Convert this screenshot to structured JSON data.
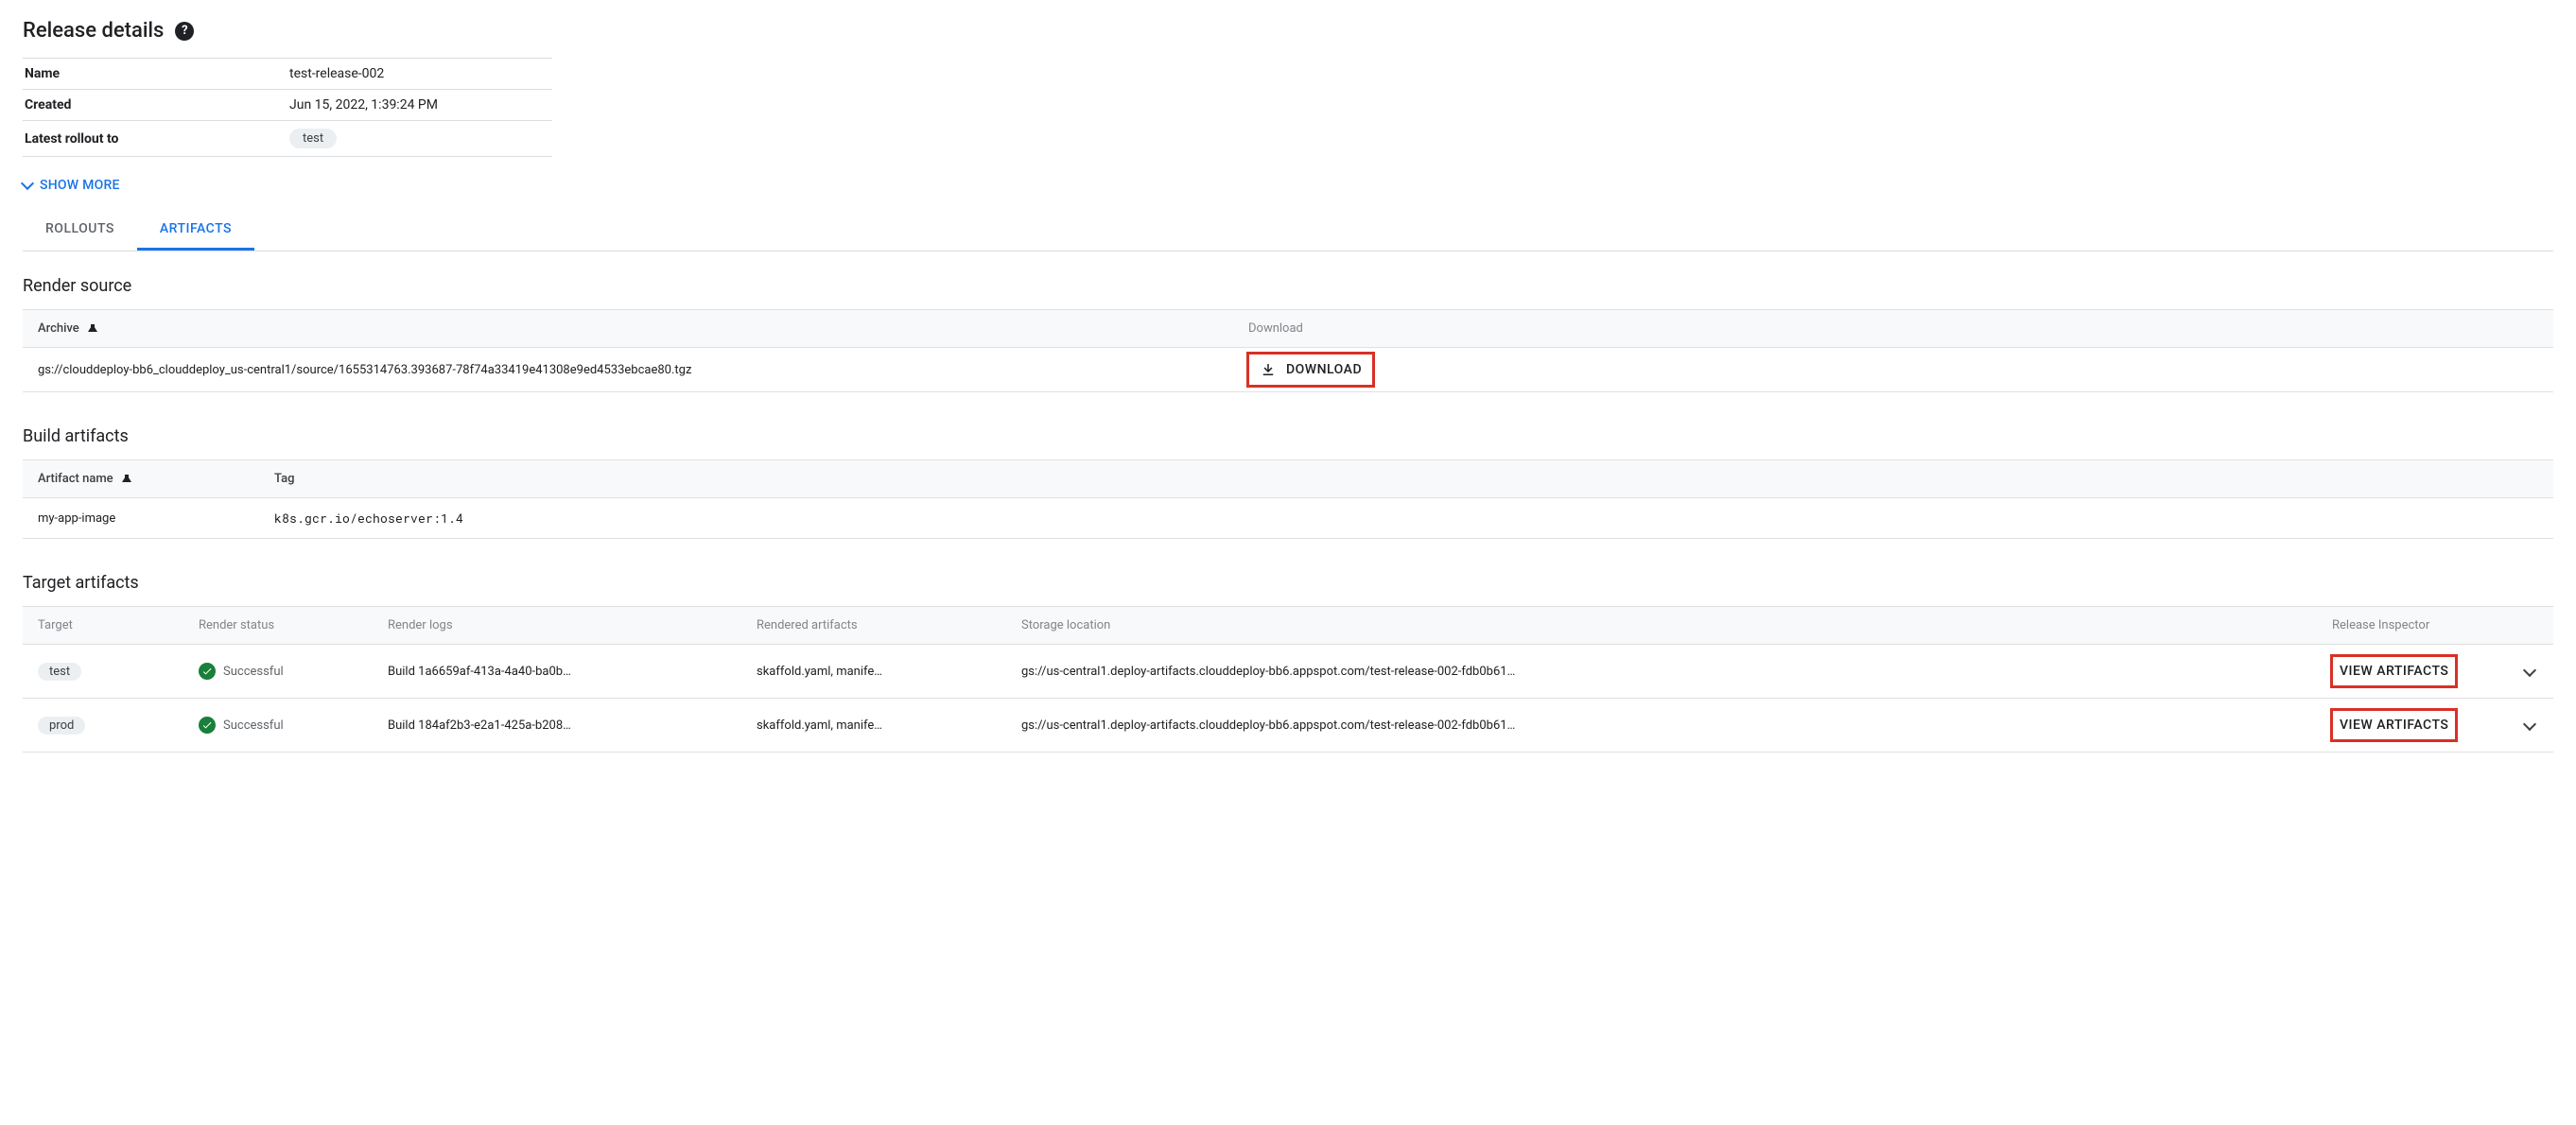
{
  "header": {
    "title": "Release details",
    "help_icon_label": "?"
  },
  "details": {
    "rows": [
      {
        "label": "Name",
        "value": "test-release-002",
        "is_chip": false
      },
      {
        "label": "Created",
        "value": "Jun 15, 2022, 1:39:24 PM",
        "is_chip": false
      },
      {
        "label": "Latest rollout to",
        "value": "test",
        "is_chip": true
      }
    ],
    "show_more_label": "SHOW MORE"
  },
  "tabs": {
    "items": [
      {
        "label": "ROLLOUTS",
        "active": false
      },
      {
        "label": "ARTIFACTS",
        "active": true
      }
    ]
  },
  "render_source": {
    "title": "Render source",
    "columns": {
      "archive": "Archive",
      "download": "Download"
    },
    "row": {
      "archive": "gs://clouddeploy-bb6_clouddeploy_us-central1/source/1655314763.393687-78f74a33419e41308e9ed4533ebcae80.tgz",
      "download_label": "DOWNLOAD"
    }
  },
  "build_artifacts": {
    "title": "Build artifacts",
    "columns": {
      "name": "Artifact name",
      "tag": "Tag"
    },
    "rows": [
      {
        "name": "my-app-image",
        "tag": "k8s.gcr.io/echoserver:1.4"
      }
    ]
  },
  "target_artifacts": {
    "title": "Target artifacts",
    "columns": {
      "target": "Target",
      "status": "Render status",
      "logs": "Render logs",
      "rendered": "Rendered artifacts",
      "storage": "Storage location",
      "inspector": "Release Inspector"
    },
    "status_label": "Successful",
    "view_label": "VIEW ARTIFACTS",
    "rows": [
      {
        "target": "test",
        "logs": "Build 1a6659af-413a-4a40-ba0b…",
        "rendered": "skaffold.yaml, manife…",
        "storage": "gs://us-central1.deploy-artifacts.clouddeploy-bb6.appspot.com/test-release-002-fdb0b61…"
      },
      {
        "target": "prod",
        "logs": "Build 184af2b3-e2a1-425a-b208…",
        "rendered": "skaffold.yaml, manife…",
        "storage": "gs://us-central1.deploy-artifacts.clouddeploy-bb6.appspot.com/test-release-002-fdb0b61…"
      }
    ]
  }
}
